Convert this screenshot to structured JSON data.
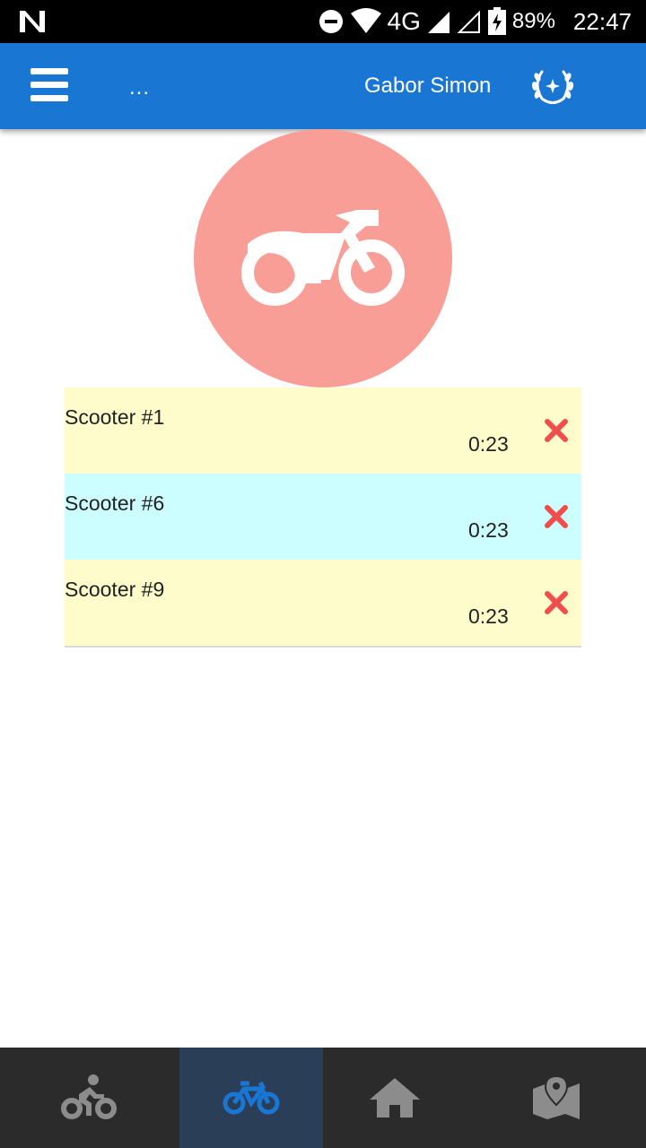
{
  "status_bar": {
    "network": "4G",
    "battery": "89%",
    "time": "22:47"
  },
  "app_bar": {
    "title": "...",
    "user_name": "Gabor Simon"
  },
  "hero": {
    "icon": "motorcycle-icon",
    "color": "#f89e97"
  },
  "rentals": [
    {
      "name": "Scooter #1",
      "time": "0:23",
      "bg": "#fffccc"
    },
    {
      "name": "Scooter #6",
      "time": "0:23",
      "bg": "#ccfeff"
    },
    {
      "name": "Scooter #9",
      "time": "0:23",
      "bg": "#fffccc"
    }
  ],
  "bottom_nav": {
    "items": [
      {
        "icon": "cyclist-icon",
        "active": false
      },
      {
        "icon": "bicycle-icon",
        "active": true
      },
      {
        "icon": "home-icon",
        "active": false
      },
      {
        "icon": "map-icon",
        "active": false
      }
    ],
    "active_color": "#1976d2",
    "inactive_color": "#8c8c8c"
  },
  "colors": {
    "primary": "#1976d2",
    "remove": "#f24d4d"
  }
}
